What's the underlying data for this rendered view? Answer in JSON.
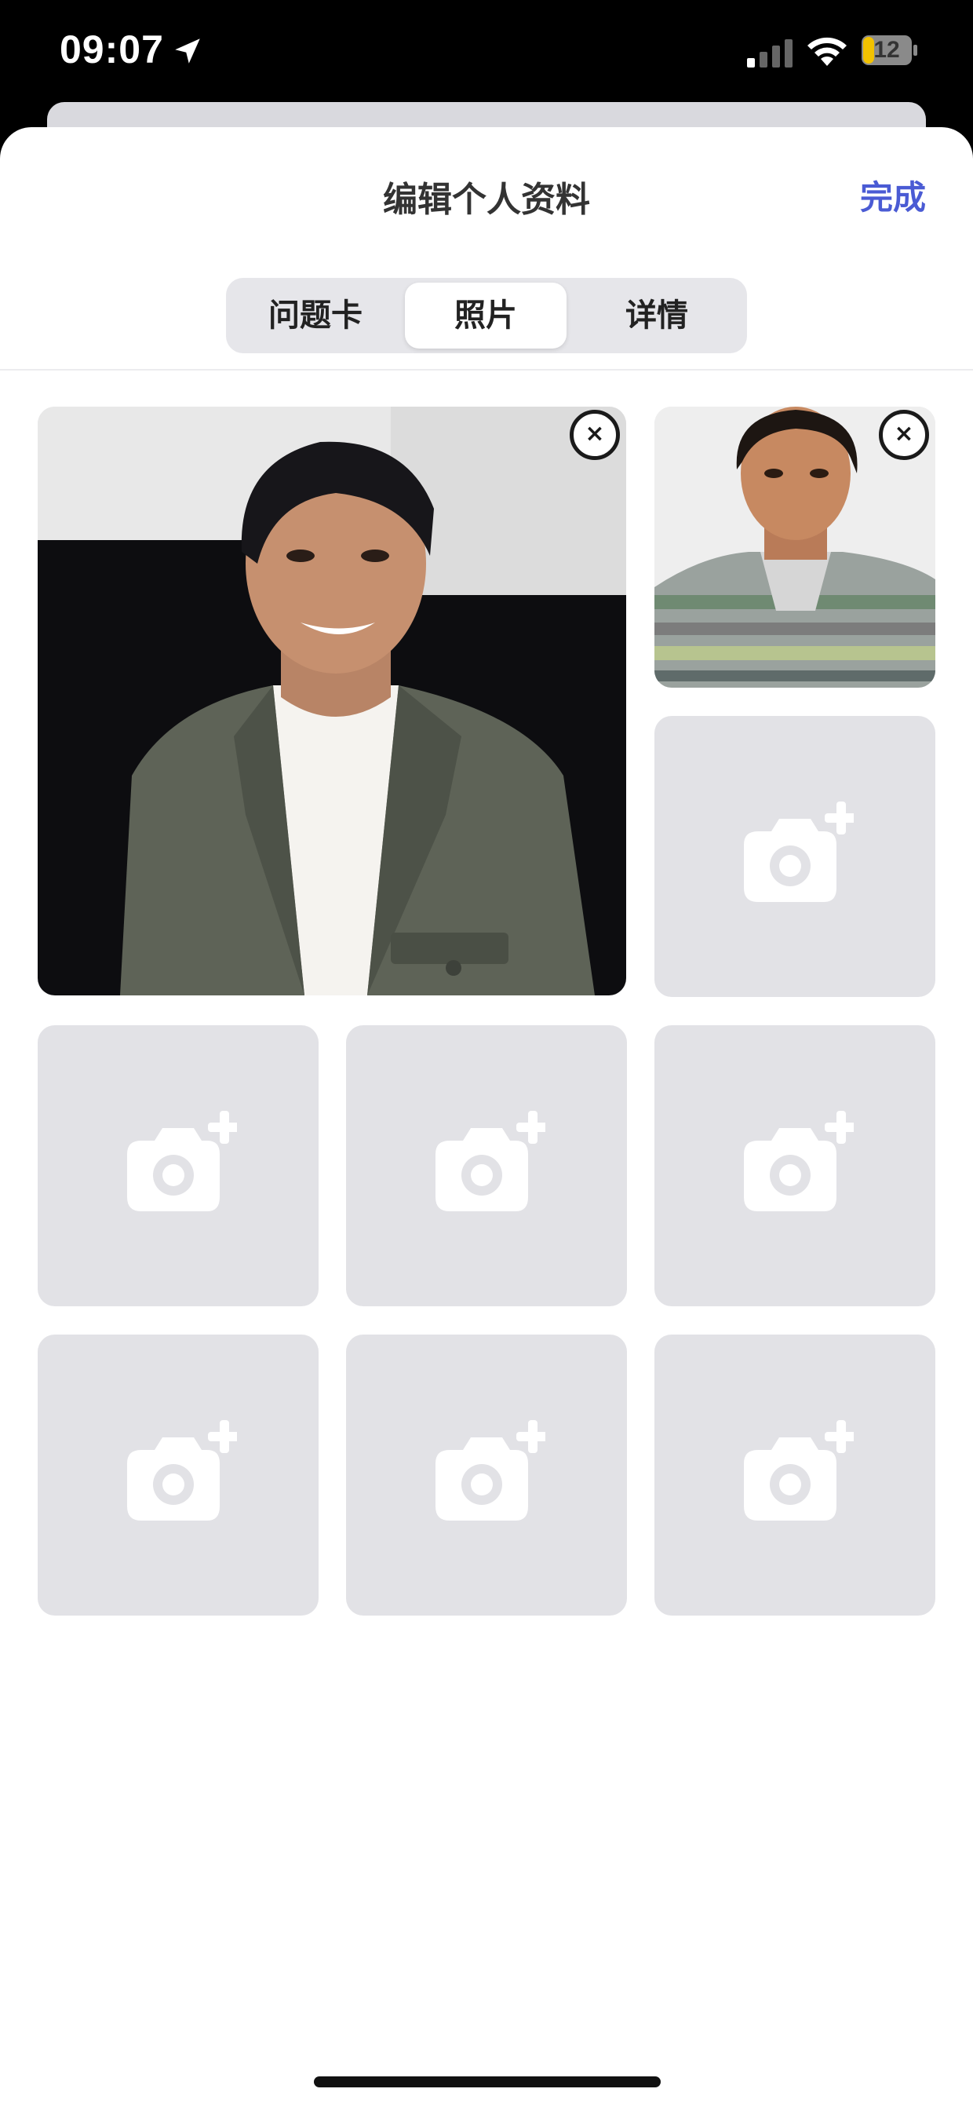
{
  "status_bar": {
    "time": "09:07",
    "battery": "12"
  },
  "header": {
    "title": "编辑个人资料",
    "done_label": "完成"
  },
  "tabs": [
    {
      "label": "问题卡",
      "active": false
    },
    {
      "label": "照片",
      "active": true
    },
    {
      "label": "详情",
      "active": false
    }
  ],
  "photos": {
    "main_photo": "portrait of man in olive green suit and white shirt",
    "second_photo": "portrait of man in striped collared shirt",
    "remove_label": "×",
    "empty_slots": 7,
    "add_icon": "camera-plus-icon"
  },
  "colors": {
    "accent": "#4a5bd4",
    "tile_bg": "#e2e2e6",
    "segment_bg": "#e6e6ea"
  }
}
